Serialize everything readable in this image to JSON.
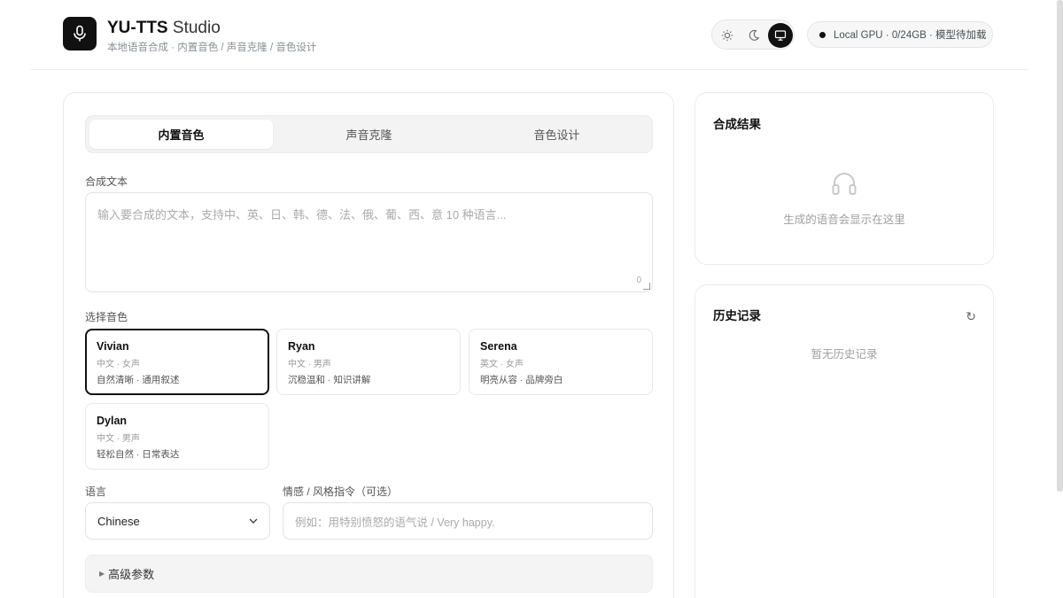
{
  "header": {
    "title_bold": "YU-TTS",
    "title_light": "Studio",
    "subtitle": "本地语音合成 · 内置音色 / 声音克隆 / 音色设计",
    "theme_options": [
      "sun-icon",
      "moon-icon",
      "monitor-icon"
    ],
    "theme_selected": "monitor-icon",
    "status": "Local GPU · 0/24GB · 模型待加载"
  },
  "tabs": [
    {
      "label": "内置音色",
      "active": true
    },
    {
      "label": "声音克隆",
      "active": false
    },
    {
      "label": "音色设计",
      "active": false
    }
  ],
  "form": {
    "text_label": "合成文本",
    "text_placeholder": "输入要合成的文本，支持中、英、日、韩、德、法、俄、葡、西、意 10 种语言...",
    "char_count": "0",
    "voice_label": "选择音色",
    "voices": [
      {
        "name": "Vivian",
        "meta": "中文 · 女声",
        "desc": "自然清晰 · 通用叙述",
        "selected": true
      },
      {
        "name": "Ryan",
        "meta": "中文 · 男声",
        "desc": "沉稳温和 · 知识讲解",
        "selected": false
      },
      {
        "name": "Serena",
        "meta": "英文 · 女声",
        "desc": "明亮从容 · 品牌旁白",
        "selected": false
      },
      {
        "name": "Dylan",
        "meta": "中文 · 男声",
        "desc": "轻松自然 · 日常表达",
        "selected": false
      }
    ],
    "language_label": "语言",
    "language_value": "Chinese",
    "style_label": "情感 / 风格指令（可选）",
    "style_placeholder": "例如：用特别愤怒的语气说 / Very happy.",
    "advanced_label": "高级参数"
  },
  "result": {
    "title": "合成结果",
    "empty_text": "生成的语音会显示在这里"
  },
  "history": {
    "title": "历史记录",
    "empty_text": "暂无历史记录",
    "refresh_glyph": "↻"
  },
  "colors": {
    "accent": "#111111",
    "border": "#ebebeb",
    "muted_text": "#a0a0a0"
  }
}
